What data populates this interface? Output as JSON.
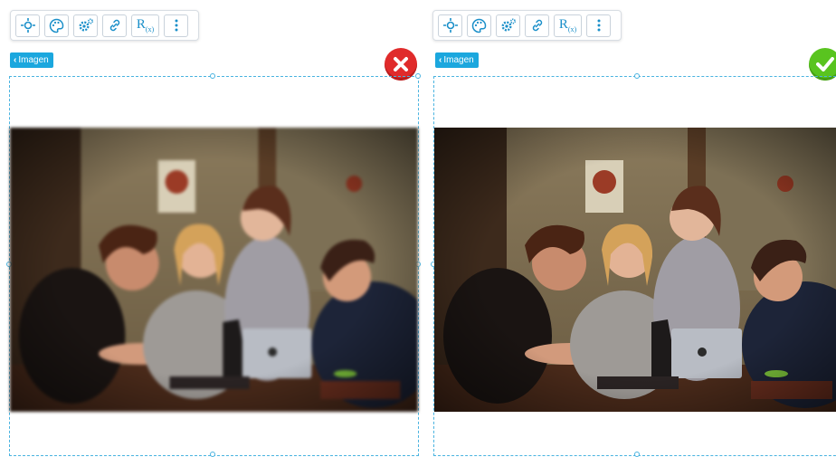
{
  "left": {
    "toolbar": {
      "buttons": [
        "move-icon",
        "palette-icon",
        "settings-icon",
        "link-icon",
        "rx-icon",
        "more-vertical-icon"
      ],
      "rx_label": "R",
      "rx_sub": "(x)"
    },
    "tag": {
      "label": "Imagen"
    },
    "status": "error"
  },
  "right": {
    "toolbar": {
      "buttons": [
        "move-icon",
        "palette-icon",
        "settings-icon",
        "link-icon",
        "rx-icon",
        "more-vertical-icon"
      ],
      "rx_label": "R",
      "rx_sub": "(x)"
    },
    "tag": {
      "label": "Imagen"
    },
    "status": "ok"
  },
  "colors": {
    "accent": "#1ba7de",
    "error": "#e02b2b",
    "success": "#59c41f"
  }
}
